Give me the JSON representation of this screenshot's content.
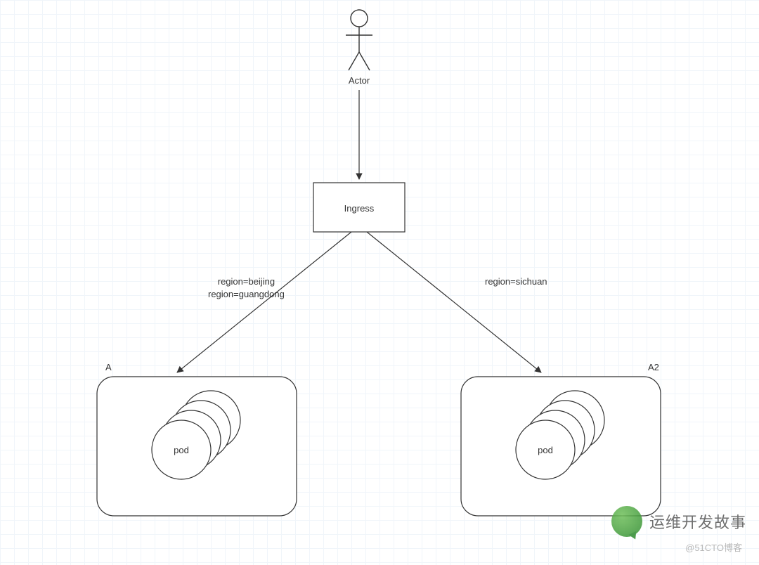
{
  "actor": {
    "label": "Actor"
  },
  "ingress": {
    "label": "Ingress"
  },
  "edges": {
    "left": {
      "line1": "region=beijing",
      "line2": "region=guangdong"
    },
    "right": {
      "line1": "region=sichuan"
    }
  },
  "groupA": {
    "title": "A",
    "pod_label": "pod"
  },
  "groupA2": {
    "title": "A2",
    "pod_label": "pod"
  },
  "watermark": {
    "text": "运维开发故事"
  },
  "attribution": "@51CTO博客"
}
